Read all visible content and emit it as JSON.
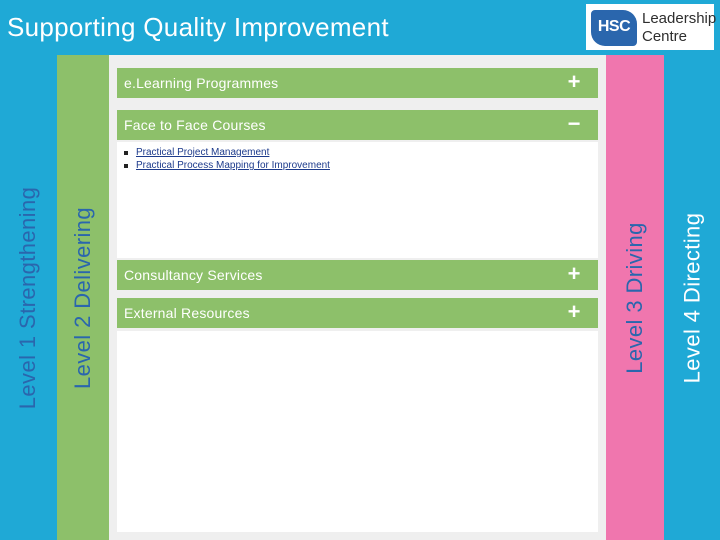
{
  "header": {
    "title": "Supporting Quality Improvement",
    "logo": {
      "mark": "HSC",
      "line1": "Leadership",
      "line2": "Centre"
    }
  },
  "tabs": [
    {
      "label": "Level 1 Strengthening",
      "color": "#1fa9d6"
    },
    {
      "label": "Level 2 Delivering",
      "color": "#8dc06a"
    },
    {
      "label": "Level 3 Driving",
      "color": "#f076ae"
    },
    {
      "label": "Level 4 Directing",
      "color": "#1fa9d6"
    }
  ],
  "accordion": [
    {
      "label": "e.Learning Programmes",
      "toggle": "+",
      "expanded": false
    },
    {
      "label": "Face to Face Courses",
      "toggle": "−",
      "expanded": true,
      "items": [
        "Practical Project Management",
        "Practical Process Mapping for Improvement"
      ]
    },
    {
      "label": "Consultancy Services",
      "toggle": "+",
      "expanded": false
    },
    {
      "label": "External Resources",
      "toggle": "+",
      "expanded": false
    }
  ],
  "colors": {
    "accent_blue": "#1fa9d6",
    "accent_green": "#8dc06a",
    "accent_pink": "#f076ae",
    "text_dark_blue": "#2a66ad",
    "link": "#1d3b8c"
  }
}
